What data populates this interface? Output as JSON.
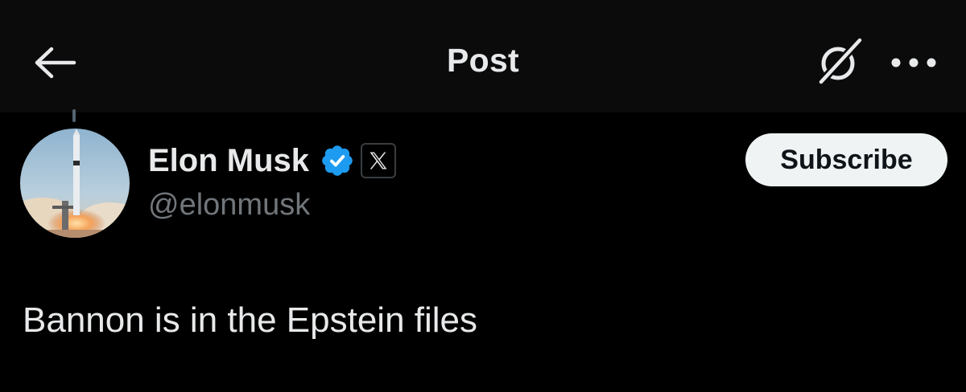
{
  "header": {
    "title": "Post",
    "back_icon": "arrow-left-icon",
    "grok_icon": "grok-icon",
    "more_icon": "more-dots-icon"
  },
  "author": {
    "name": "Elon Musk",
    "handle": "@elonmusk",
    "verified_icon": "verified-badge-icon",
    "affiliate_icon": "x-logo-icon",
    "avatar": "rocket-launch-avatar"
  },
  "actions": {
    "subscribe_label": "Subscribe"
  },
  "post": {
    "text": "Bannon is in the Epstein files"
  },
  "colors": {
    "background": "#000000",
    "header_background": "#0b0b0c",
    "primary_text": "#e7e9ea",
    "secondary_text": "#71767b",
    "verified_blue": "#1d9bf0",
    "button_background": "#eff3f4",
    "button_text": "#0f1419"
  }
}
